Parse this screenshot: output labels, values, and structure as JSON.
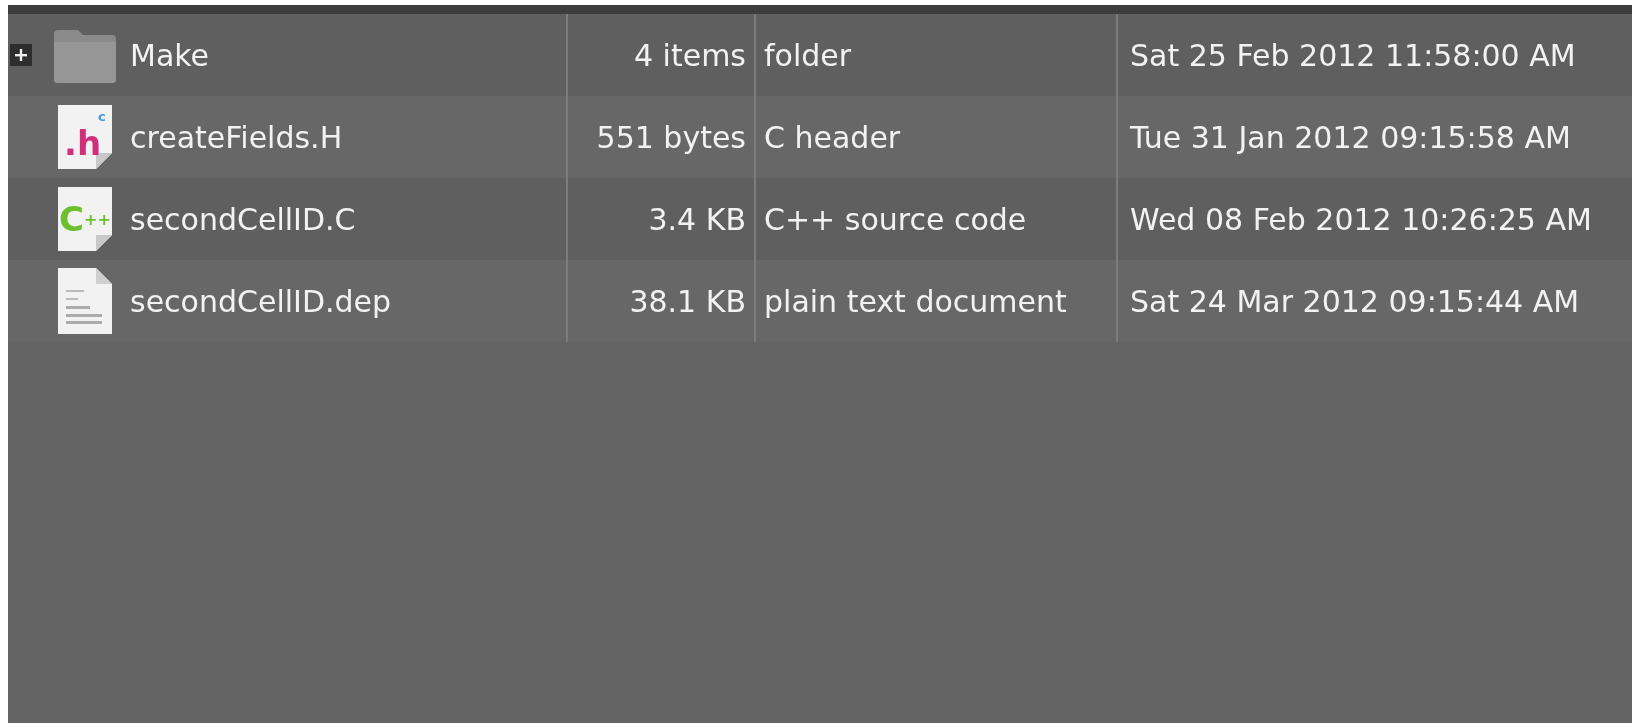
{
  "file_list": {
    "rows": [
      {
        "kind": "folder",
        "expanded": false,
        "name": "Make",
        "size": "4 items",
        "type": "folder",
        "modified": "Sat 25 Feb 2012 11:58:00 AM"
      },
      {
        "kind": "header",
        "icon_label": ".h",
        "icon_badge": "c",
        "name": "createFields.H",
        "size": "551 bytes",
        "type": "C header",
        "modified": "Tue 31 Jan 2012 09:15:58 AM"
      },
      {
        "kind": "cpp",
        "icon_label": "C",
        "icon_badge": "++",
        "name": "secondCellID.C",
        "size": "3.4 KB",
        "type": "C++ source code",
        "modified": "Wed 08 Feb 2012 10:26:25 AM"
      },
      {
        "kind": "text",
        "name": "secondCellID.dep",
        "size": "38.1 KB",
        "type": "plain text document",
        "modified": "Sat 24 Mar 2012 09:15:44 AM"
      }
    ]
  }
}
